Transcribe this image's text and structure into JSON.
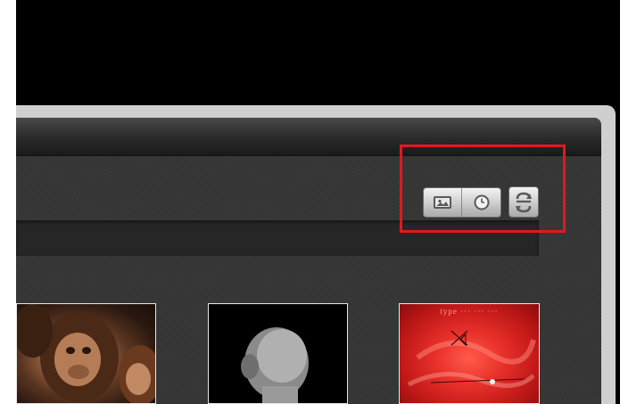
{
  "toolbar": {
    "view_toggle": [
      {
        "icon": "photo-icon"
      },
      {
        "icon": "clock-icon"
      }
    ],
    "refresh": {
      "icon": "refresh-icon"
    }
  },
  "highlight": {
    "color": "#e0191e"
  },
  "thumbnails": [
    {
      "subject": "orangutan-photo",
      "caption": ""
    },
    {
      "subject": "monkey-photo",
      "caption": ""
    },
    {
      "subject": "red-album-cover",
      "caption": "type  ···  ···  ···"
    }
  ]
}
